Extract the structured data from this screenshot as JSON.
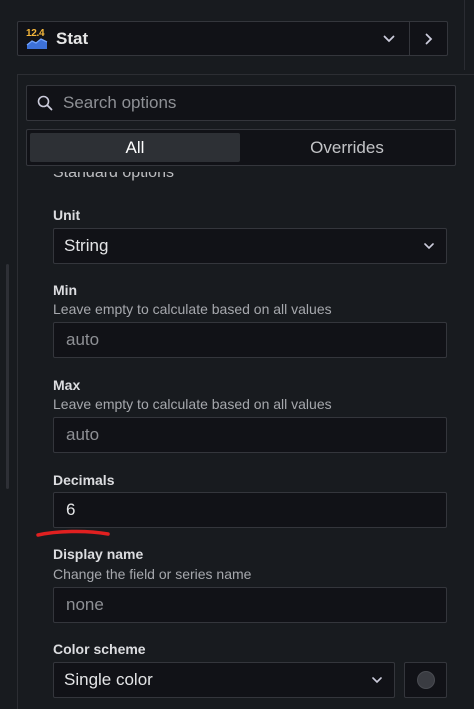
{
  "viz_picker": {
    "badge": "12.4",
    "name": "Stat",
    "icon": "stat-viz-icon"
  },
  "search": {
    "placeholder": "Search options"
  },
  "tabs": [
    {
      "label": "All",
      "active": true
    },
    {
      "label": "Overrides",
      "active": false
    }
  ],
  "section": {
    "title": "Standard options"
  },
  "fields": {
    "unit": {
      "label": "Unit",
      "value": "String"
    },
    "min": {
      "label": "Min",
      "description": "Leave empty to calculate based on all values",
      "placeholder": "auto"
    },
    "max": {
      "label": "Max",
      "description": "Leave empty to calculate based on all values",
      "placeholder": "auto"
    },
    "decimals": {
      "label": "Decimals",
      "value": "6"
    },
    "display_name": {
      "label": "Display name",
      "description": "Change the field or series name",
      "placeholder": "none"
    },
    "color_scheme": {
      "label": "Color scheme",
      "value": "Single color"
    }
  },
  "colors": {
    "accent": "#f5b73b",
    "annotation": "#e02020"
  }
}
